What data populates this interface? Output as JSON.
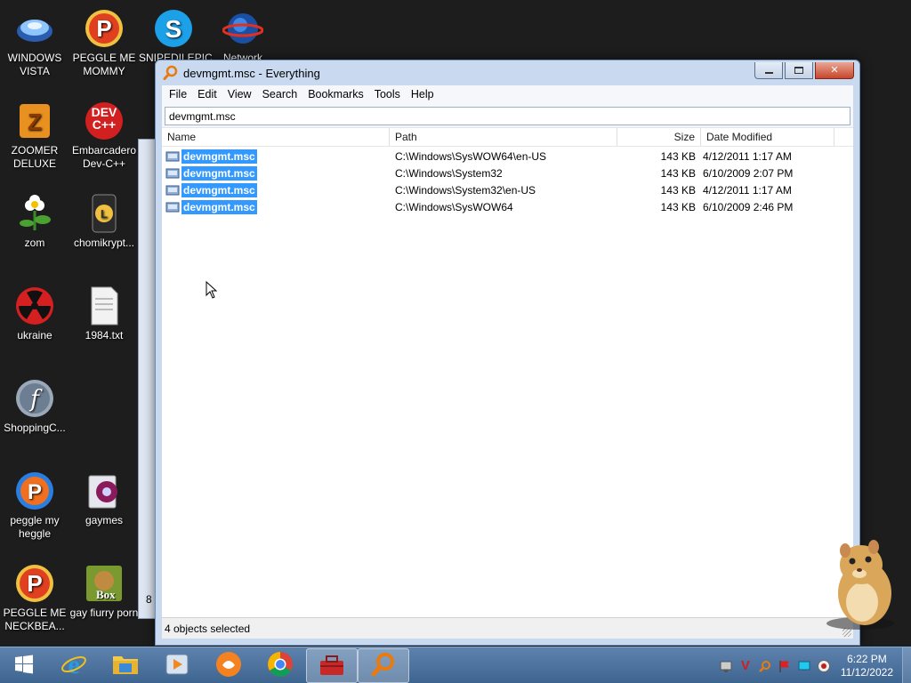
{
  "desktop": {
    "icons": [
      {
        "label": "WINDOWS VISTA"
      },
      {
        "label": "PEGGLE ME MOMMY"
      },
      {
        "label": "SNIPEDILEPIC GA..."
      },
      {
        "label": "Network"
      },
      {
        "label": "ZOOMER DELUXE"
      },
      {
        "label": "Embarcadero Dev-C++"
      },
      {
        "label": "zom"
      },
      {
        "label": "chomikrypt..."
      },
      {
        "label": "ukraine"
      },
      {
        "label": "1984.txt"
      },
      {
        "label": "ShoppingC..."
      },
      {
        "label": "peggle my heggle"
      },
      {
        "label": "gaymes"
      },
      {
        "label": "PEGGLE ME NECKBEA..."
      },
      {
        "label": "gay fiurry porn"
      }
    ],
    "dev_icon_text": "DEV C++",
    "box_icon_text": "Box",
    "bg_window_fragment": "8"
  },
  "window": {
    "title": "devmgmt.msc - Everything",
    "menu": [
      "File",
      "Edit",
      "View",
      "Search",
      "Bookmarks",
      "Tools",
      "Help"
    ],
    "search_value": "devmgmt.msc",
    "columns": {
      "name": "Name",
      "path": "Path",
      "size": "Size",
      "date": "Date Modified"
    },
    "rows": [
      {
        "name": "devmgmt.msc",
        "path": "C:\\Windows\\SysWOW64\\en-US",
        "size": "143 KB",
        "date": "4/12/2011 1:17 AM"
      },
      {
        "name": "devmgmt.msc",
        "path": "C:\\Windows\\System32",
        "size": "143 KB",
        "date": "6/10/2009 2:07 PM"
      },
      {
        "name": "devmgmt.msc",
        "path": "C:\\Windows\\System32\\en-US",
        "size": "143 KB",
        "date": "4/12/2011 1:17 AM"
      },
      {
        "name": "devmgmt.msc",
        "path": "C:\\Windows\\SysWOW64",
        "size": "143 KB",
        "date": "6/10/2009 2:46 PM"
      }
    ],
    "status": "4 objects selected"
  },
  "taskbar": {
    "clock_time": "6:22 PM",
    "clock_date": "11/12/2022"
  },
  "colors": {
    "selection": "#3399ff",
    "title_bg": "#c9daf0",
    "taskbar": "#4a70a0"
  }
}
